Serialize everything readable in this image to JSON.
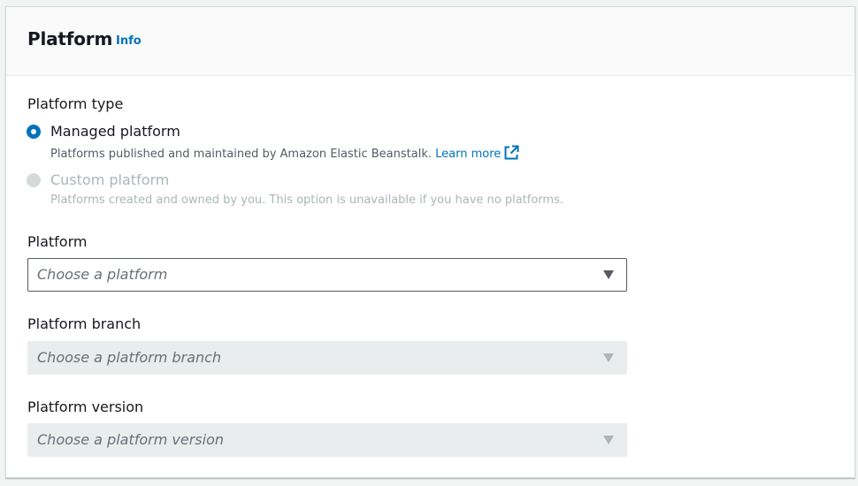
{
  "panel": {
    "title": "Platform",
    "info_link": "Info"
  },
  "platform_type": {
    "label": "Platform type",
    "options": [
      {
        "label": "Managed platform",
        "description": "Platforms published and maintained by Amazon Elastic Beanstalk.",
        "link": "Learn more",
        "selected": true,
        "disabled": false
      },
      {
        "label": "Custom platform",
        "description": "Platforms created and owned by you. This option is unavailable if you have no platforms.",
        "selected": false,
        "disabled": true
      }
    ]
  },
  "platform": {
    "label": "Platform",
    "placeholder": "Choose a platform",
    "disabled": false
  },
  "platform_branch": {
    "label": "Platform branch",
    "placeholder": "Choose a platform branch",
    "disabled": true
  },
  "platform_version": {
    "label": "Platform version",
    "placeholder": "Choose a platform version",
    "disabled": true
  },
  "colors": {
    "accent": "#0073bb",
    "text": "#16191f",
    "muted": "#545b64",
    "disabled": "#aab7b8",
    "disabled_bg": "#eaeded"
  }
}
